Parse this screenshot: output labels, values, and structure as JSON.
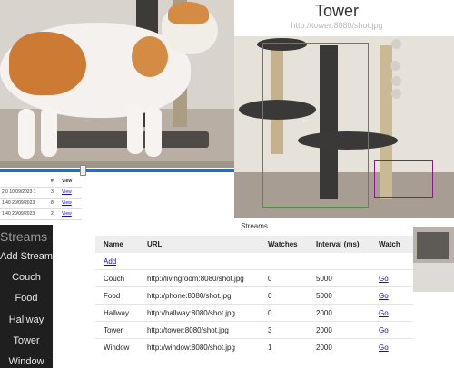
{
  "tower": {
    "title": "Tower",
    "url": "http://tower:8080/shot.jpg"
  },
  "mini_table": {
    "headers": [
      "",
      "#",
      "View"
    ],
    "rows": [
      {
        "time": "2.0 10/09/2023 1",
        "count": "3",
        "link": "View"
      },
      {
        "time": "1.40 20/09/2023",
        "count": "8",
        "link": "View"
      },
      {
        "time": "1.40 20/09/2023",
        "count": "2",
        "link": "View"
      }
    ]
  },
  "sidebar": {
    "title": "Streams",
    "items": [
      {
        "label": "Add Stream"
      },
      {
        "label": "Couch"
      },
      {
        "label": "Food"
      },
      {
        "label": "Hallway"
      },
      {
        "label": "Tower"
      },
      {
        "label": "Window"
      }
    ]
  },
  "streams": {
    "title": "Streams",
    "headers": [
      "Name",
      "URL",
      "Watches",
      "Interval (ms)",
      "Watch"
    ],
    "add_label": "Add",
    "rows": [
      {
        "name": "Couch",
        "url": "http://livingroom:8080/shot.jpg",
        "watches": "0",
        "interval": "5000",
        "watch": "Go"
      },
      {
        "name": "Food",
        "url": "http://phone:8080/shot.jpg",
        "watches": "0",
        "interval": "5000",
        "watch": "Go"
      },
      {
        "name": "Hallway",
        "url": "http://hallway:8080/shot.jpg",
        "watches": "0",
        "interval": "2000",
        "watch": "Go"
      },
      {
        "name": "Tower",
        "url": "http://tower:8080/shot.jpg",
        "watches": "3",
        "interval": "2000",
        "watch": "Go"
      },
      {
        "name": "Window",
        "url": "http://window:8080/shot.jpg",
        "watches": "1",
        "interval": "2000",
        "watch": "Go"
      }
    ]
  },
  "colors": {
    "sidebar_bg": "#1f1f1f",
    "link": "#1a0dab",
    "detection_primary": "#2aa82a",
    "detection_secondary": "#8a1a8a",
    "split_bar": "#2e6ea8"
  }
}
